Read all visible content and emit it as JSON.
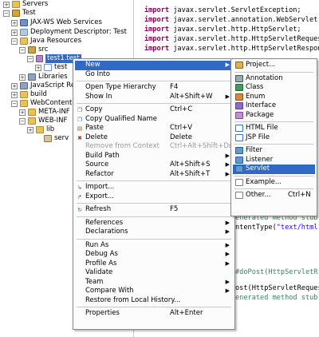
{
  "tree": {
    "items": [
      {
        "label": "Servers",
        "icon": "folder-icon",
        "toggle": "+"
      },
      {
        "label": "Test",
        "icon": "project-icon",
        "toggle": "−"
      },
      {
        "label": "JAX-WS Web Services",
        "icon": "webservice-icon",
        "toggle": "+"
      },
      {
        "label": "Deployment Descriptor: Test",
        "icon": "descriptor-icon",
        "toggle": "+"
      },
      {
        "label": "Java Resources",
        "icon": "folder-icon",
        "toggle": "−"
      },
      {
        "label": "src",
        "icon": "source-folder-icon",
        "toggle": "−"
      },
      {
        "label": "test1.test",
        "icon": "package-icon",
        "toggle": "−"
      },
      {
        "label": "test",
        "icon": "java-file-icon",
        "toggle": "+"
      },
      {
        "label": "Libraries",
        "icon": "library-icon",
        "toggle": "+"
      },
      {
        "label": "JavaScript Res",
        "icon": "library-icon",
        "toggle": "+"
      },
      {
        "label": "build",
        "icon": "folder-icon",
        "toggle": "+"
      },
      {
        "label": "WebContent",
        "icon": "folder-icon",
        "toggle": "−"
      },
      {
        "label": "META-INF",
        "icon": "folder-icon",
        "toggle": "+"
      },
      {
        "label": "WEB-INF",
        "icon": "folder-icon",
        "toggle": "−"
      },
      {
        "label": "lib",
        "icon": "folder-icon",
        "toggle": "+"
      },
      {
        "label": "serv",
        "icon": "jar-icon",
        "toggle": ""
      }
    ]
  },
  "editor": {
    "lines": [
      {
        "kw": "import",
        "rest": " javax.servlet.ServletException;"
      },
      {
        "kw": "import",
        "rest": " javax.servlet.annotation.WebServlet;"
      },
      {
        "kw": "import",
        "rest": " javax.servlet.http.HttpServlet;"
      },
      {
        "kw": "import",
        "rest": " javax.servlet.http.HttpServletReques"
      },
      {
        "kw": "import",
        "rest": " javax.servlet.http.HttpServletRespon"
      }
    ],
    "lower": [
      {
        "text": "enerated method stub",
        "cls": "cm"
      },
      {
        "text": "ntentType(\"text/html\"",
        "cls": ""
      },
      {
        "text": "#doPost(HttpServletR",
        "cls": "cm"
      },
      {
        "text": "ost(HttpServletReques",
        "cls": ""
      },
      {
        "text": "enerated method stub",
        "cls": "cm"
      }
    ]
  },
  "context_menu": {
    "items": [
      {
        "label": "New",
        "shortcut": "",
        "submenu": true,
        "highlight": true
      },
      {
        "label": "Go Into",
        "shortcut": ""
      },
      {
        "sep": true
      },
      {
        "label": "Open Type Hierarchy",
        "shortcut": "F4"
      },
      {
        "label": "Show In",
        "shortcut": "Alt+Shift+W",
        "submenu": true
      },
      {
        "sep": true
      },
      {
        "label": "Copy",
        "shortcut": "Ctrl+C",
        "icon": "copy-icon"
      },
      {
        "label": "Copy Qualified Name",
        "shortcut": "",
        "icon": "copy-icon"
      },
      {
        "label": "Paste",
        "shortcut": "Ctrl+V",
        "icon": "paste-icon"
      },
      {
        "label": "Delete",
        "shortcut": "Delete",
        "icon": "delete-icon"
      },
      {
        "label": "Remove from Context",
        "shortcut": "Ctrl+Alt+Shift+Down",
        "disabled": true
      },
      {
        "label": "Build Path",
        "shortcut": "",
        "submenu": true
      },
      {
        "label": "Source",
        "shortcut": "Alt+Shift+S",
        "submenu": true
      },
      {
        "label": "Refactor",
        "shortcut": "Alt+Shift+T",
        "submenu": true
      },
      {
        "sep": true
      },
      {
        "label": "Import...",
        "shortcut": "",
        "icon": "import-icon"
      },
      {
        "label": "Export...",
        "shortcut": "",
        "icon": "export-icon"
      },
      {
        "sep": true
      },
      {
        "label": "Refresh",
        "shortcut": "F5",
        "icon": "refresh-icon"
      },
      {
        "sep": true
      },
      {
        "label": "References",
        "shortcut": "",
        "submenu": true
      },
      {
        "label": "Declarations",
        "shortcut": "",
        "submenu": true
      },
      {
        "sep": true
      },
      {
        "label": "Run As",
        "shortcut": "",
        "submenu": true
      },
      {
        "label": "Debug As",
        "shortcut": "",
        "submenu": true
      },
      {
        "label": "Profile As",
        "shortcut": "",
        "submenu": true
      },
      {
        "label": "Validate",
        "shortcut": ""
      },
      {
        "label": "Team",
        "shortcut": "",
        "submenu": true
      },
      {
        "label": "Compare With",
        "shortcut": "",
        "submenu": true
      },
      {
        "label": "Restore from Local History...",
        "shortcut": ""
      },
      {
        "sep": true
      },
      {
        "label": "Properties",
        "shortcut": "Alt+Enter"
      }
    ]
  },
  "submenu": {
    "items": [
      {
        "label": "Project...",
        "shortcut": "",
        "icon": "ic-proj2"
      },
      {
        "sep": true
      },
      {
        "label": "Annotation",
        "shortcut": "",
        "icon": "ic-ann"
      },
      {
        "label": "Class",
        "shortcut": "",
        "icon": "ic-cls"
      },
      {
        "label": "Enum",
        "shortcut": "",
        "icon": "ic-enum"
      },
      {
        "label": "Interface",
        "shortcut": "",
        "icon": "ic-intf"
      },
      {
        "label": "Package",
        "shortcut": "",
        "icon": "ic-pk"
      },
      {
        "sep": true
      },
      {
        "label": "HTML File",
        "shortcut": "",
        "icon": "ic-html"
      },
      {
        "label": "JSP File",
        "shortcut": "",
        "icon": "ic-jsp"
      },
      {
        "sep": true
      },
      {
        "label": "Filter",
        "shortcut": "",
        "icon": "ic-flt"
      },
      {
        "label": "Listener",
        "shortcut": "",
        "icon": "ic-lsn"
      },
      {
        "label": "Servlet",
        "shortcut": "",
        "icon": "ic-srv",
        "highlight": true
      },
      {
        "sep": true
      },
      {
        "label": "Example...",
        "shortcut": "",
        "icon": "ic-ex"
      },
      {
        "sep": true
      },
      {
        "label": "Other...",
        "shortcut": "Ctrl+N",
        "icon": "ic-oth"
      }
    ]
  },
  "colors": {
    "selection": "#3169c6",
    "keyword": "#7f0055",
    "comment": "#3f7f5f",
    "string": "#2a00ff"
  }
}
